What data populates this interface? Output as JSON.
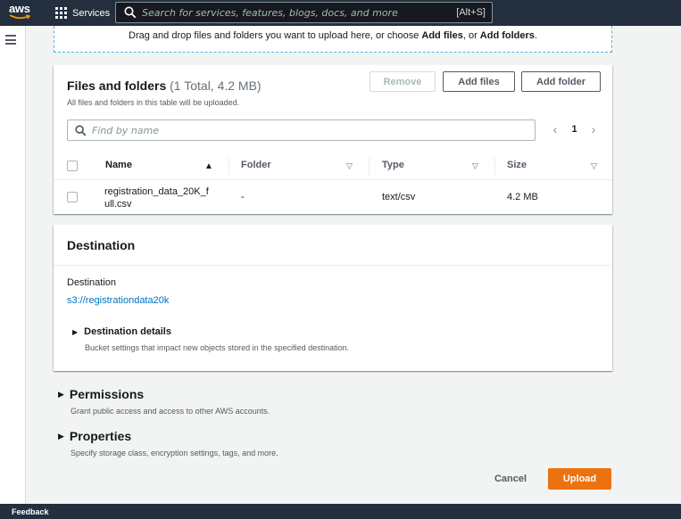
{
  "topnav": {
    "logo_text": "aws",
    "services_label": "Services",
    "search_placeholder": "Search for services, features, blogs, docs, and more",
    "search_shortcut": "[Alt+S]"
  },
  "dropzone": {
    "text_prefix": "Drag and drop files and folders you want to upload here, or choose ",
    "add_files": "Add files",
    "text_mid": ", or ",
    "add_folders": "Add folders",
    "text_suffix": "."
  },
  "files": {
    "title": "Files and folders",
    "count": "(1 Total, 4.2 MB)",
    "subtitle": "All files and folders in this table will be uploaded.",
    "remove_label": "Remove",
    "add_files_label": "Add files",
    "add_folder_label": "Add folder",
    "find_placeholder": "Find by name",
    "page_number": "1",
    "columns": [
      "Name",
      "Folder",
      "Type",
      "Size"
    ],
    "rows": [
      {
        "name_line1": "registration_data_20K_f",
        "name_line2": "ull.csv",
        "folder": "-",
        "type": "text/csv",
        "size": "4.2 MB"
      }
    ]
  },
  "destination": {
    "title": "Destination",
    "label": "Destination",
    "link": "s3://registrationdata20k",
    "details_title": "Destination details",
    "details_desc": "Bucket settings that impact new objects stored in the specified destination."
  },
  "permissions": {
    "title": "Permissions",
    "desc": "Grant public access and access to other AWS accounts."
  },
  "properties": {
    "title": "Properties",
    "desc": "Specify storage class, encryption settings, tags, and more."
  },
  "actions": {
    "cancel_label": "Cancel",
    "upload_label": "Upload"
  },
  "footer": {
    "feedback_label": "Feedback"
  },
  "colors": {
    "nav_bg": "#232f3e",
    "accent_orange": "#ec7211",
    "link_blue": "#0073bb"
  }
}
